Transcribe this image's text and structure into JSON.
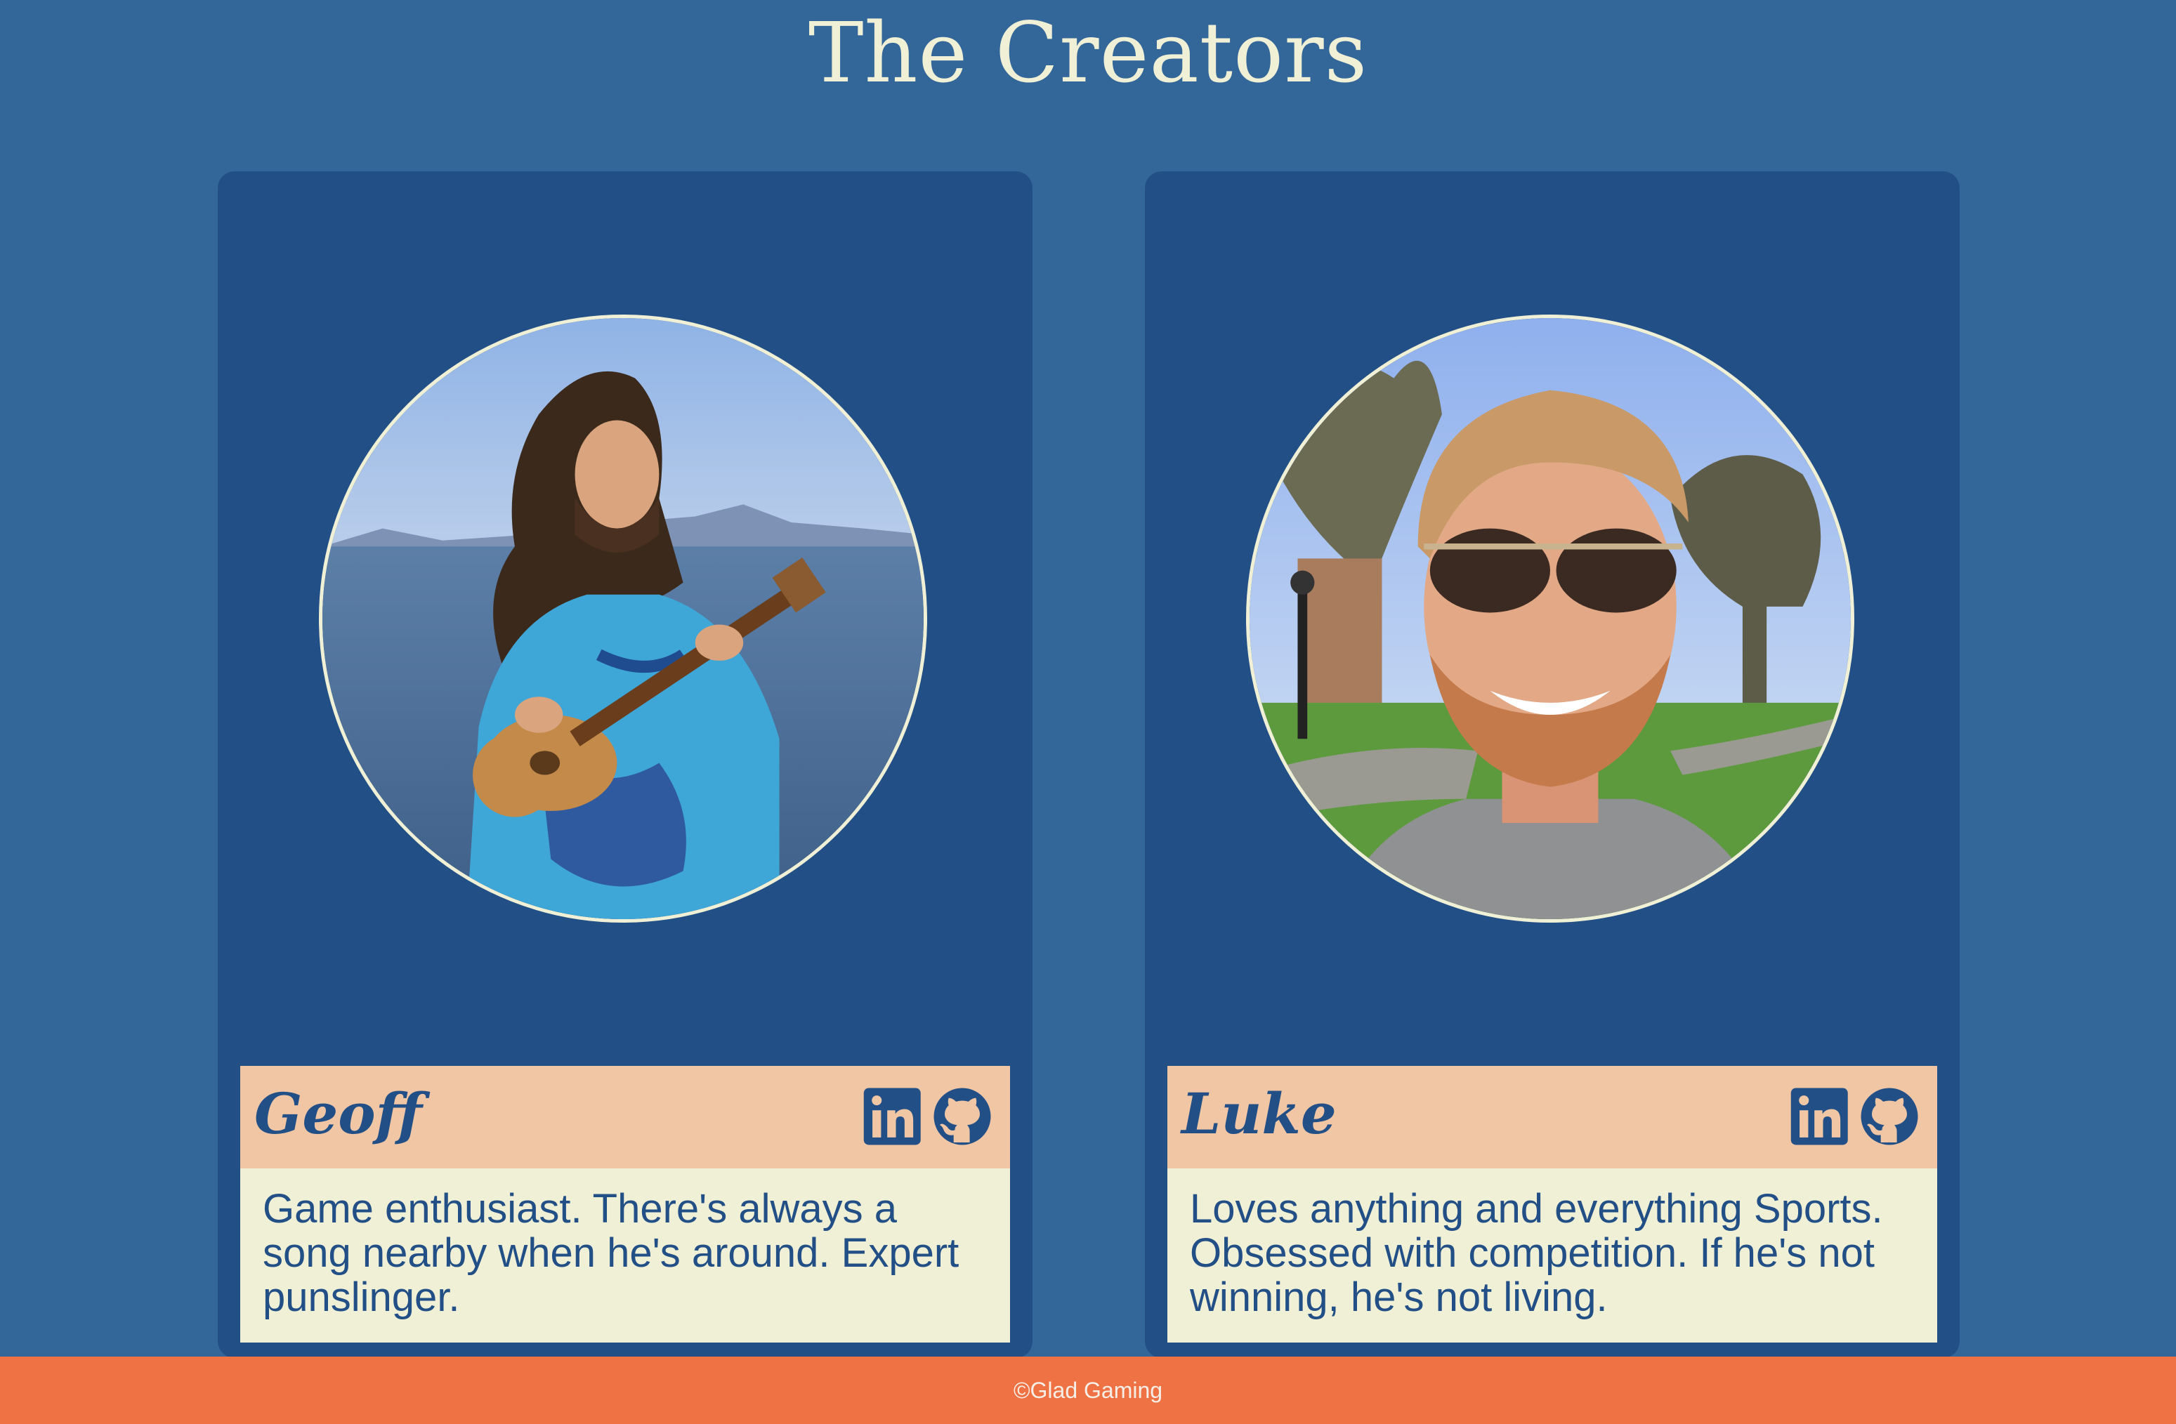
{
  "header": {
    "title": "The Creators"
  },
  "creators": [
    {
      "name": "Geoff",
      "bio": "Game enthusiast. There's always a song nearby when he's around. Expert punslinger.",
      "photo_icon": "person-with-ukulele-photo",
      "links": [
        "linkedin-icon",
        "github-icon"
      ]
    },
    {
      "name": "Luke",
      "bio": "Loves anything and everything Sports. Obsessed with competition. If he's not winning, he's not living.",
      "photo_icon": "person-in-sunglasses-photo",
      "links": [
        "linkedin-icon",
        "github-icon"
      ]
    }
  ],
  "footer": {
    "copyright": "©Glad Gaming"
  },
  "colors": {
    "page_bg": "#336699",
    "card_bg": "#224f86",
    "name_bar": "#f0c6a5",
    "bio_bg": "#f0f0d6",
    "footer_bg": "#ee7244",
    "title_text": "#f0f0d6"
  }
}
